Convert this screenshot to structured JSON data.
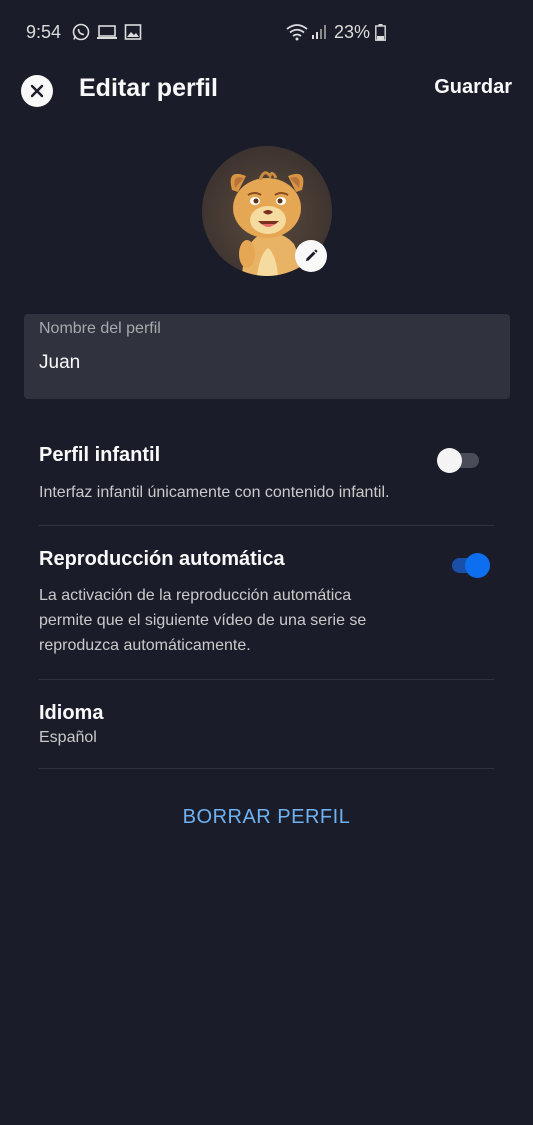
{
  "status": {
    "time": "9:54",
    "battery": "23%",
    "icons": [
      "whatsapp-icon",
      "laptop-icon",
      "image-icon",
      "wifi-icon",
      "signal-icon",
      "battery-icon"
    ]
  },
  "header": {
    "title": "Editar perfil",
    "save_label": "Guardar",
    "close_icon": "close-icon"
  },
  "profile": {
    "avatar": "simba-avatar",
    "edit_icon": "pencil-icon",
    "name_label": "Nombre del perfil",
    "name_value": "Juan"
  },
  "settings": {
    "kids": {
      "title": "Perfil infantil",
      "description": "Interfaz infantil únicamente con contenido infantil.",
      "enabled": false
    },
    "autoplay": {
      "title": "Reproducción automática",
      "description_lines": [
        "La activación de la reproducción automática",
        "permite que el siguiente vídeo de una serie se",
        "reproduzca automáticamente."
      ],
      "enabled": true
    },
    "language": {
      "title": "Idioma",
      "value": "Español"
    }
  },
  "actions": {
    "delete_label": "BORRAR PERFIL"
  },
  "colors": {
    "background": "#1a1d29",
    "field": "#30333e",
    "accent": "#0e6ef0",
    "link": "#6fb2f2"
  }
}
